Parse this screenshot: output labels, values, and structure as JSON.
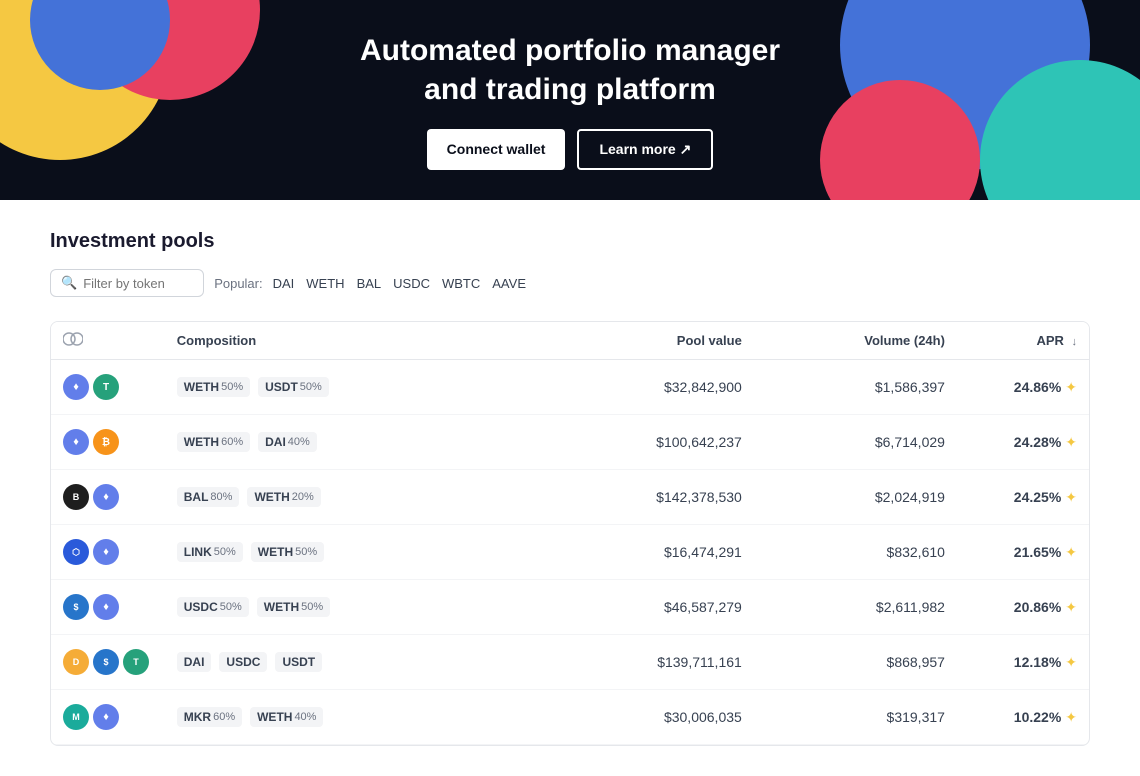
{
  "hero": {
    "title_line1": "Automated portfolio manager",
    "title_line2": "and trading platform",
    "btn_connect": "Connect wallet",
    "btn_learn": "Learn more ↗"
  },
  "investment_pools": {
    "section_title": "Investment pools",
    "filter_placeholder": "Filter by token",
    "popular_label": "Popular:",
    "popular_tokens": [
      "DAI",
      "WETH",
      "BAL",
      "USDC",
      "WBTC",
      "AAVE"
    ],
    "table": {
      "headers": [
        "",
        "Composition",
        "Pool value",
        "Volume (24h)",
        "APR ↓"
      ],
      "rows": [
        {
          "tokens": [
            "ETH",
            "USDT"
          ],
          "composition": [
            {
              "name": "WETH",
              "pct": "50%"
            },
            {
              "name": "USDT",
              "pct": "50%"
            }
          ],
          "pool_value": "$32,842,900",
          "volume": "$1,586,397",
          "apr": "24.86%"
        },
        {
          "tokens": [
            "ETH",
            "BTC"
          ],
          "composition": [
            {
              "name": "WETH",
              "pct": "60%"
            },
            {
              "name": "DAI",
              "pct": "40%"
            }
          ],
          "pool_value": "$100,642,237",
          "volume": "$6,714,029",
          "apr": "24.28%"
        },
        {
          "tokens": [
            "BAL",
            "ETH"
          ],
          "composition": [
            {
              "name": "BAL",
              "pct": "80%"
            },
            {
              "name": "WETH",
              "pct": "20%"
            }
          ],
          "pool_value": "$142,378,530",
          "volume": "$2,024,919",
          "apr": "24.25%"
        },
        {
          "tokens": [
            "LINK",
            "ETH"
          ],
          "composition": [
            {
              "name": "LINK",
              "pct": "50%"
            },
            {
              "name": "WETH",
              "pct": "50%"
            }
          ],
          "pool_value": "$16,474,291",
          "volume": "$832,610",
          "apr": "21.65%"
        },
        {
          "tokens": [
            "USDC",
            "ETH"
          ],
          "composition": [
            {
              "name": "USDC",
              "pct": "50%"
            },
            {
              "name": "WETH",
              "pct": "50%"
            }
          ],
          "pool_value": "$46,587,279",
          "volume": "$2,611,982",
          "apr": "20.86%"
        },
        {
          "tokens": [
            "DAI",
            "USDC",
            "USDT"
          ],
          "composition": [
            {
              "name": "DAI",
              "pct": ""
            },
            {
              "name": "USDC",
              "pct": ""
            },
            {
              "name": "USDT",
              "pct": ""
            }
          ],
          "pool_value": "$139,711,161",
          "volume": "$868,957",
          "apr": "12.18%"
        },
        {
          "tokens": [
            "MKR",
            "ETH"
          ],
          "composition": [
            {
              "name": "MKR",
              "pct": "60%"
            },
            {
              "name": "WETH",
              "pct": "40%"
            }
          ],
          "pool_value": "$30,006,035",
          "volume": "$319,317",
          "apr": "10.22%"
        }
      ]
    }
  }
}
